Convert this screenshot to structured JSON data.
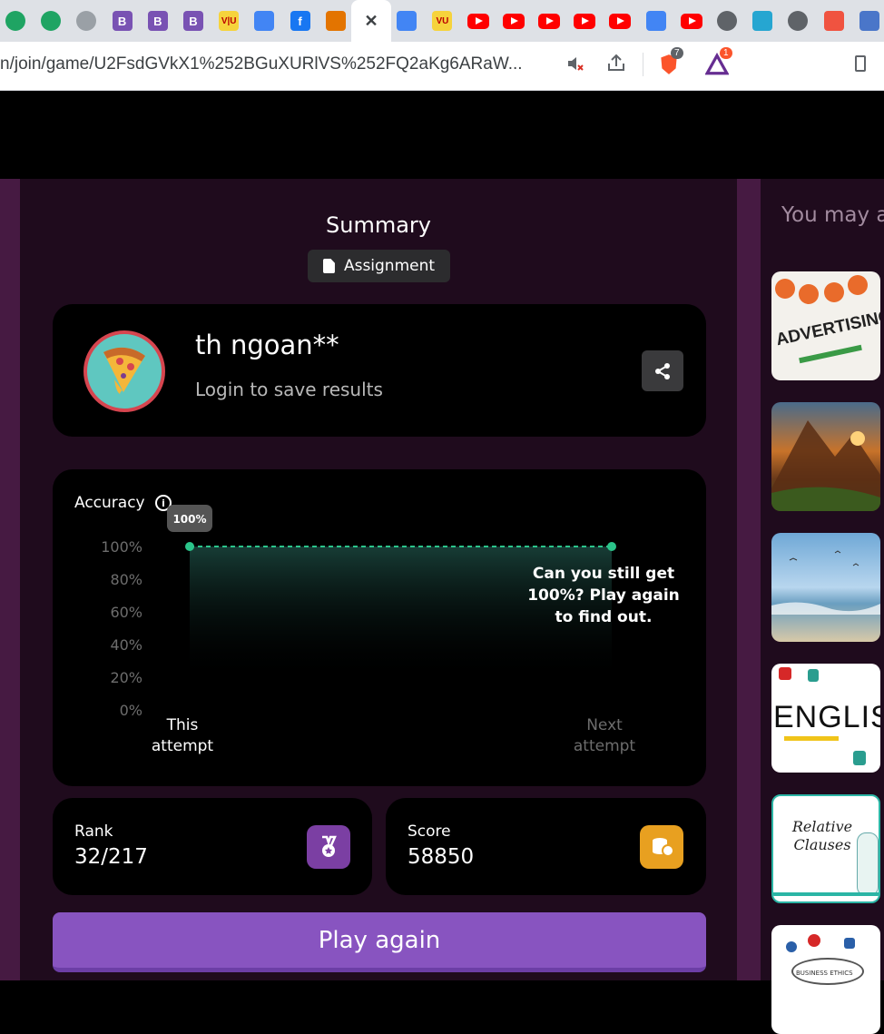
{
  "browser": {
    "tabs": [
      {
        "icon": "google-drive-icon"
      },
      {
        "icon": "google-drive-icon"
      },
      {
        "icon": "bot-icon"
      },
      {
        "icon": "bootstrap-icon",
        "text": "B"
      },
      {
        "icon": "bootstrap-icon",
        "text": "B"
      },
      {
        "icon": "bootstrap-icon",
        "text": "B"
      },
      {
        "icon": "vu-icon",
        "text": "V|U"
      },
      {
        "icon": "google-translate-icon"
      },
      {
        "icon": "facebook-icon",
        "text": "f"
      },
      {
        "icon": "contact-icon"
      },
      {
        "icon": "close-icon",
        "text": "✕"
      },
      {
        "icon": "google-docs-icon"
      },
      {
        "icon": "vu-icon",
        "text": "VU"
      },
      {
        "icon": "youtube-icon"
      },
      {
        "icon": "youtube-icon"
      },
      {
        "icon": "youtube-icon"
      },
      {
        "icon": "youtube-icon"
      },
      {
        "icon": "youtube-icon"
      },
      {
        "icon": "google-translate-icon"
      },
      {
        "icon": "youtube-icon"
      },
      {
        "icon": "speaker-icon"
      },
      {
        "icon": "app-icon"
      },
      {
        "icon": "globe-icon"
      },
      {
        "icon": "laravel-icon"
      },
      {
        "icon": "flag-icon"
      },
      {
        "icon": "google-icon",
        "text": "G"
      }
    ],
    "url": "n/join/game/U2FsdGVkX1%252BGuXURlVS%252FQ2aKg6ARaW...",
    "brave_badge": "7",
    "rewards_badge": "1"
  },
  "summary": {
    "title": "Summary",
    "assignment_label": "Assignment"
  },
  "player": {
    "name": "th ngoan**",
    "login_prompt": "Login to save results"
  },
  "accuracy": {
    "label": "Accuracy",
    "bubble": "100%",
    "y_ticks": [
      "100%",
      "80%",
      "60%",
      "40%",
      "20%",
      "0%"
    ],
    "x_labels": [
      "This attempt",
      "Next attempt"
    ],
    "message": "Can you still get 100%? Play again to find out."
  },
  "chart_data": {
    "type": "area",
    "categories": [
      "This attempt",
      "Next attempt"
    ],
    "values": [
      100,
      100
    ],
    "ylim": [
      0,
      100
    ],
    "ylabel": "",
    "xlabel": ""
  },
  "stats": {
    "rank_label": "Rank",
    "rank_value": "32/217",
    "score_label": "Score",
    "score_value": "58850"
  },
  "actions": {
    "play_again": "Play again"
  },
  "sidebar": {
    "title": "You may a",
    "thumbs": [
      "ADVERTISING",
      "",
      "",
      "ENGLISH",
      "Relative Clauses",
      "BUSINESS ETHICS"
    ]
  },
  "colors": {
    "accent": "#8854c0",
    "chart_line": "#2bc48a",
    "rank_icon": "#7b3fa3",
    "score_icon": "#e8a020"
  }
}
